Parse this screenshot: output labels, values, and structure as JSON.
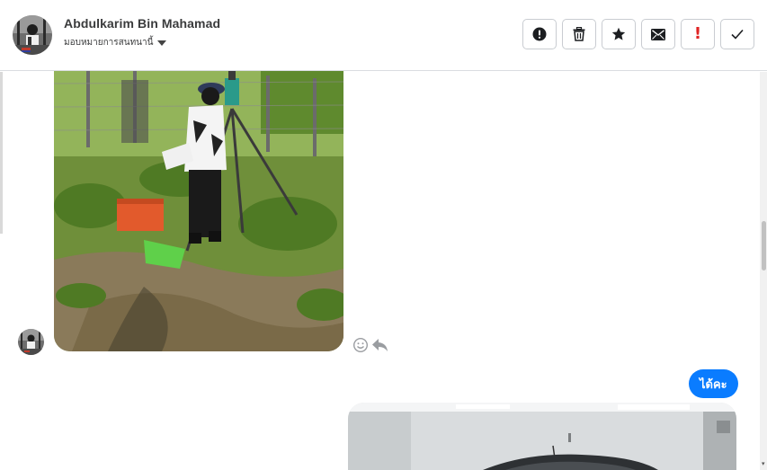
{
  "header": {
    "contact_name": "Abdulkarim Bin Mahamad",
    "assign_label": "มอบหมายการสนทนานี้",
    "actions": [
      {
        "name": "mark-spam",
        "icon": "exclamation-circle-icon"
      },
      {
        "name": "delete",
        "icon": "trash-icon"
      },
      {
        "name": "star",
        "icon": "star-icon"
      },
      {
        "name": "mark-unread",
        "icon": "envelope-icon"
      },
      {
        "name": "important",
        "icon": "exclamation-red-icon"
      },
      {
        "name": "done",
        "icon": "checkmark-icon"
      }
    ]
  },
  "messages": [
    {
      "direction": "incoming",
      "type": "photo",
      "subject": "surveyor-with-theodolite"
    },
    {
      "direction": "outgoing",
      "type": "text",
      "text": "ได้คะ"
    },
    {
      "direction": "outgoing",
      "type": "photo",
      "subject": "car-in-showroom"
    }
  ],
  "colors": {
    "outgoing_bubble": "#0a7cff",
    "important_red": "#e02424",
    "text_dark": "#3a3b3c"
  }
}
